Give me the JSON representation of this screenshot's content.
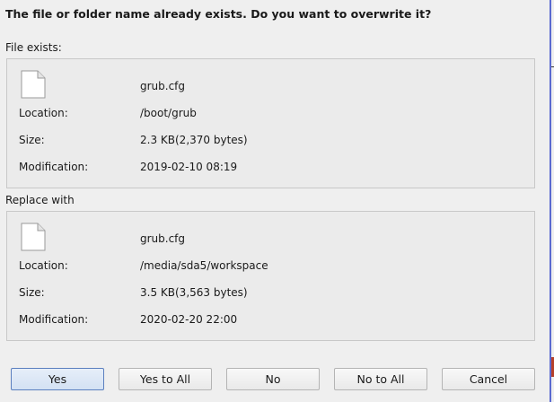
{
  "dialog": {
    "question": "The file or folder name already exists. Do you want to overwrite it?"
  },
  "existing": {
    "section_label": "File exists:",
    "icon": "file-icon",
    "name": "grub.cfg",
    "location_label": "Location:",
    "location": "/boot/grub",
    "size_label": "Size:",
    "size": "2.3 KB(2,370 bytes)",
    "modification_label": "Modification:",
    "modification": "2019-02-10 08:19"
  },
  "replacement": {
    "section_label": "Replace with",
    "icon": "file-icon",
    "name": "grub.cfg",
    "location_label": "Location:",
    "location": "/media/sda5/workspace",
    "size_label": "Size:",
    "size": "3.5 KB(3,563 bytes)",
    "modification_label": "Modification:",
    "modification": "2020-02-20 22:00"
  },
  "buttons": {
    "yes": "Yes",
    "yes_to_all": "Yes to All",
    "no": "No",
    "no_to_all": "No to All",
    "cancel": "Cancel"
  },
  "colors": {
    "background": "#efefef",
    "default_button_border": "#5b7fbf",
    "window_edge": "#5b6ad0"
  }
}
